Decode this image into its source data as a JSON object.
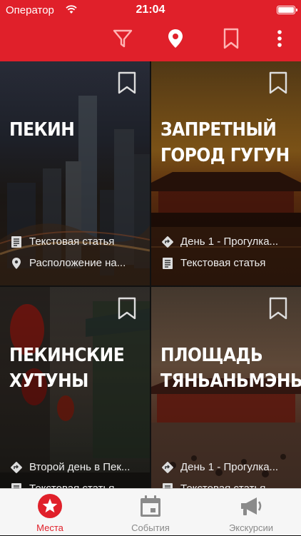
{
  "status_bar": {
    "carrier": "Оператор",
    "time": "21:04"
  },
  "toolbar": {
    "icons": [
      "filter-icon",
      "location-pin-icon",
      "bookmark-icon",
      "more-vert-icon"
    ]
  },
  "colors": {
    "accent": "#e0202a"
  },
  "cards": [
    {
      "title": "ПЕКИН",
      "meta": [
        {
          "icon": "article-icon",
          "text": "Текстовая статья"
        },
        {
          "icon": "location-icon",
          "text": "Расположение на..."
        }
      ]
    },
    {
      "title": "ЗАПРЕТНЫЙ ГОРОД ГУГУН",
      "meta": [
        {
          "icon": "route-icon",
          "text": "День 1 - Прогулка..."
        },
        {
          "icon": "article-icon",
          "text": "Текстовая статья"
        }
      ]
    },
    {
      "title": "ПЕКИНСКИЕ ХУТУНЫ",
      "meta": [
        {
          "icon": "route-icon",
          "text": "Второй день в Пек..."
        },
        {
          "icon": "article-icon",
          "text": "Текстовая статья"
        }
      ]
    },
    {
      "title": "ПЛОЩАДЬ ТЯНЬАНЬМЭНЬ",
      "meta": [
        {
          "icon": "route-icon",
          "text": "День 1 - Прогулка..."
        },
        {
          "icon": "article-icon",
          "text": "Текстовая статья"
        }
      ]
    }
  ],
  "tabs": [
    {
      "label": "Места",
      "icon": "star-icon",
      "active": true
    },
    {
      "label": "События",
      "icon": "calendar-icon",
      "active": false
    },
    {
      "label": "Экскурсии",
      "icon": "megaphone-icon",
      "active": false
    }
  ]
}
